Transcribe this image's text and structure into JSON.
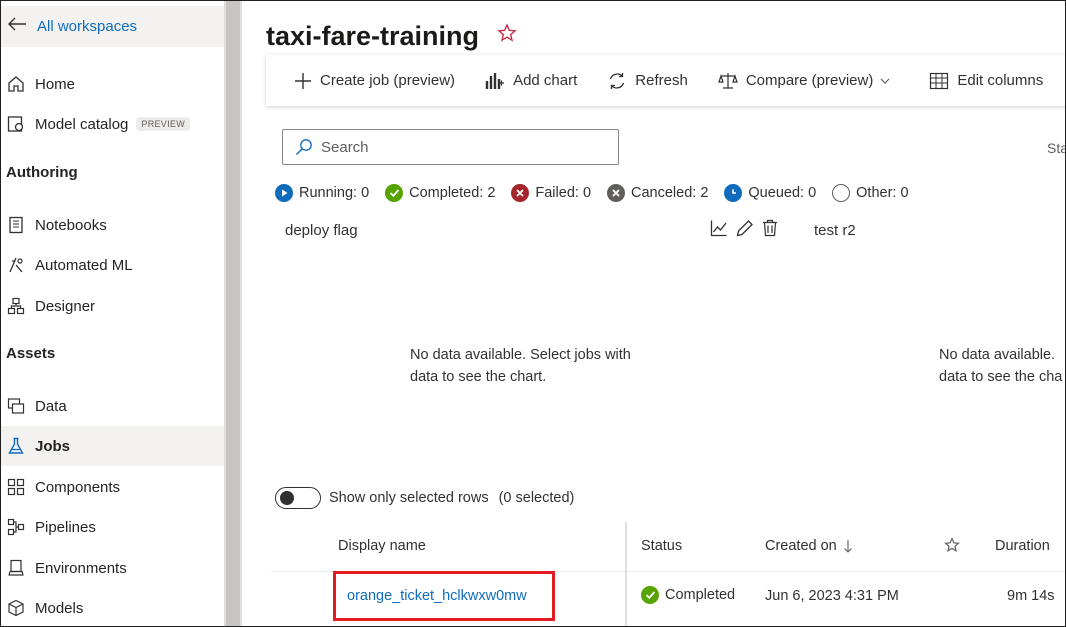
{
  "sidebar": {
    "back_label": "All workspaces",
    "items": [
      {
        "label": "Home",
        "icon": "home-icon"
      },
      {
        "label": "Model catalog",
        "icon": "model-catalog-icon",
        "badge": "PREVIEW"
      },
      {
        "label": "Notebooks",
        "icon": "notebook-icon"
      },
      {
        "label": "Automated ML",
        "icon": "automated-ml-icon"
      },
      {
        "label": "Designer",
        "icon": "designer-icon"
      },
      {
        "label": "Data",
        "icon": "data-icon"
      },
      {
        "label": "Jobs",
        "icon": "jobs-flask-icon",
        "active": true
      },
      {
        "label": "Components",
        "icon": "components-icon"
      },
      {
        "label": "Pipelines",
        "icon": "pipelines-icon"
      },
      {
        "label": "Environments",
        "icon": "environments-icon"
      },
      {
        "label": "Models",
        "icon": "models-icon"
      }
    ],
    "sections": {
      "authoring": "Authoring",
      "assets": "Assets"
    }
  },
  "page": {
    "title": "taxi-fare-training"
  },
  "toolbar": {
    "create_job": "Create job (preview)",
    "add_chart": "Add chart",
    "refresh": "Refresh",
    "compare": "Compare (preview)",
    "edit_columns": "Edit columns"
  },
  "search": {
    "placeholder": "Search"
  },
  "status_cut": "Sta",
  "status_counts": {
    "running": "Running: 0",
    "completed": "Completed: 2",
    "failed": "Failed: 0",
    "canceled": "Canceled: 2",
    "queued": "Queued: 0",
    "other": "Other: 0"
  },
  "charts": {
    "chart1_title": "deploy flag",
    "chart2_title": "test r2",
    "nodata_line1": "No data available. Select jobs with",
    "nodata_line2": "data to see the chart.",
    "nodata2_line1": "No data available.",
    "nodata2_line2": "data to see the cha"
  },
  "toggle": {
    "label": "Show only selected rows",
    "count": "(0 selected)"
  },
  "grid": {
    "headers": {
      "display_name": "Display name",
      "status": "Status",
      "created_on": "Created on",
      "duration": "Duration"
    },
    "rows": [
      {
        "display_name": "orange_ticket_hclkwxw0mw",
        "status": "Completed",
        "created_on": "Jun 6, 2023 4:31 PM",
        "duration": "9m 14s"
      }
    ]
  },
  "colors": {
    "accent": "#0f6cbd",
    "success": "#498205",
    "error": "#a4262c",
    "canceled": "#605e5c",
    "highlight": "#e31b23"
  }
}
